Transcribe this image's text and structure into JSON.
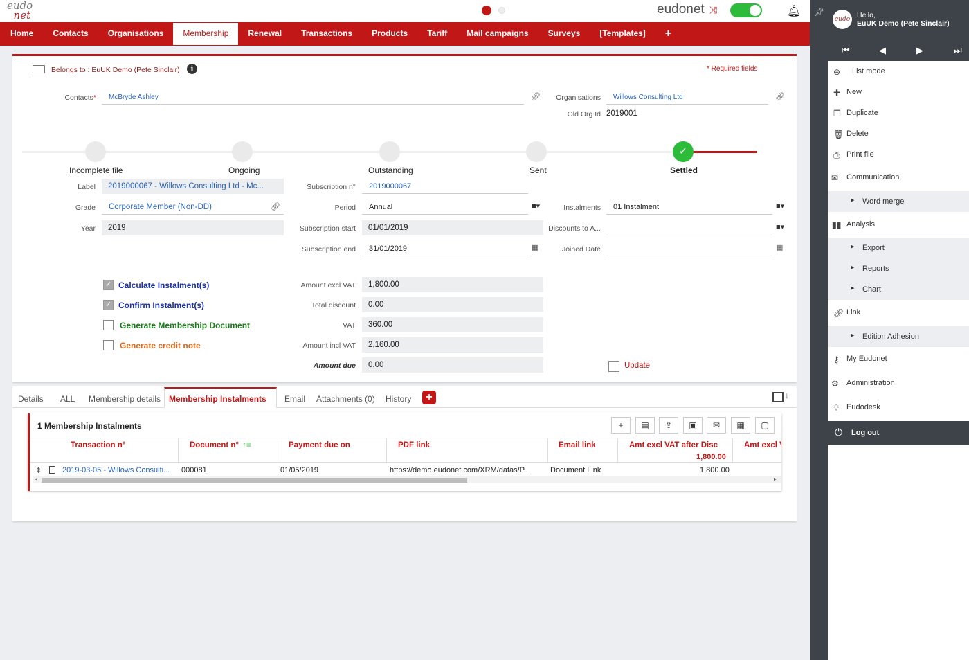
{
  "header": {
    "logo_top": "eudo",
    "logo_bottom": "net",
    "brand": "eudonet",
    "nav": [
      "Home",
      "Contacts",
      "Organisations",
      "Membership",
      "Renewal",
      "Transactions",
      "Products",
      "Tariff",
      "Mail campaigns",
      "Surveys",
      "[Templates]",
      "+"
    ],
    "active_nav": "Membership"
  },
  "form": {
    "belongs_to": "Belongs to : EuUK Demo (Pete Sinclair)",
    "required_fields": "* Required fields",
    "contacts_label": "Contacts",
    "contacts_required": "*",
    "contacts_value": "McBryde Ashley",
    "organisations_label": "Organisations",
    "organisations_value": "Willows Consulting Ltd",
    "old_org_id_label": "Old Org Id",
    "old_org_id_value": "2019001",
    "steps": [
      "Incomplete file",
      "Ongoing",
      "Outstanding",
      "Sent",
      "Settled"
    ],
    "label_label": "Label",
    "label_value": "2019000067 - Willows Consulting Ltd - Mc...",
    "grade_label": "Grade",
    "grade_value": "Corporate Member (Non-DD)",
    "year_label": "Year",
    "year_value": "2019",
    "subscription_no_label": "Subscription n°",
    "subscription_no_value": "2019000067",
    "period_label": "Period",
    "period_value": "Annual",
    "subscription_start_label": "Subscription start",
    "subscription_start_value": "01/01/2019",
    "subscription_end_label": "Subscription end",
    "subscription_end_value": "31/01/2019",
    "instalments_label": "Instalments",
    "instalments_value": "01 Instalment",
    "discounts_label": "Discounts to A...",
    "discounts_value": "",
    "joined_date_label": "Joined Date",
    "joined_date_value": "",
    "checkboxes": [
      {
        "label": "Calculate Instalment(s)",
        "checked": true,
        "color": "#1a2fa8"
      },
      {
        "label": "Confirm Instalment(s)",
        "checked": true,
        "color": "#1a2fa8"
      },
      {
        "label": "Generate Membership Document",
        "checked": false,
        "color": "#1c7a1c"
      },
      {
        "label": "Generate credit note",
        "checked": false,
        "color": "#e06a1a"
      }
    ],
    "amount_excl_vat_label": "Amount excl VAT",
    "amount_excl_vat_value": "1,800.00",
    "total_discount_label": "Total discount",
    "total_discount_value": "0.00",
    "vat_label": "VAT",
    "vat_value": "360.00",
    "amount_incl_vat_label": "Amount incl VAT",
    "amount_incl_vat_value": "2,160.00",
    "amount_due_label": "Amount due",
    "amount_due_value": "0.00",
    "update_label": "Update"
  },
  "tabs": {
    "items": [
      "Details",
      "ALL",
      "Membership details",
      "Membership Instalments",
      "Email",
      "Attachments (0)",
      "History"
    ],
    "active": "Membership Instalments"
  },
  "grid": {
    "title": "1 Membership Instalments",
    "columns": [
      "Transaction n°",
      "Document n°",
      "Payment due on",
      "PDF link",
      "Email link",
      "Amt excl VAT after Disc",
      "Amt excl V"
    ],
    "column_total": "1,800.00",
    "rows": [
      {
        "transaction": "2019-03-05 - Willows Consulti...",
        "document": "000081",
        "payment_due": "01/05/2019",
        "pdf_link": "https://demo.eudonet.com/XRM/datas/P...",
        "email_link": "Document Link",
        "amount": "1,800.00"
      }
    ]
  },
  "right_panel": {
    "greeting": "Hello,",
    "user": "EuUK Demo (Pete Sinclair)",
    "menu": [
      {
        "label": "List mode",
        "icon": "arrow-left-circle-icon"
      },
      {
        "label": "New",
        "icon": "plus-icon"
      },
      {
        "label": "Duplicate",
        "icon": "duplicate-icon"
      },
      {
        "label": "Delete",
        "icon": "trash-icon"
      },
      {
        "label": "Print file",
        "icon": "printer-icon"
      },
      {
        "label": "Communication",
        "icon": "envelope-icon"
      },
      {
        "label": "Word merge",
        "sub": true
      },
      {
        "label": "Analysis",
        "icon": "bar-chart-icon"
      },
      {
        "label": "Export",
        "sub": true
      },
      {
        "label": "Reports",
        "sub": true
      },
      {
        "label": "Chart",
        "sub": true
      },
      {
        "label": "Link",
        "icon": "link-icon"
      },
      {
        "label": "Edition Adhesion",
        "sub": true
      },
      {
        "label": "My Eudonet",
        "icon": "user-key-icon"
      },
      {
        "label": "Administration",
        "icon": "gears-icon"
      },
      {
        "label": "Eudodesk",
        "icon": "bulb-icon"
      }
    ],
    "logout": "Log out"
  }
}
